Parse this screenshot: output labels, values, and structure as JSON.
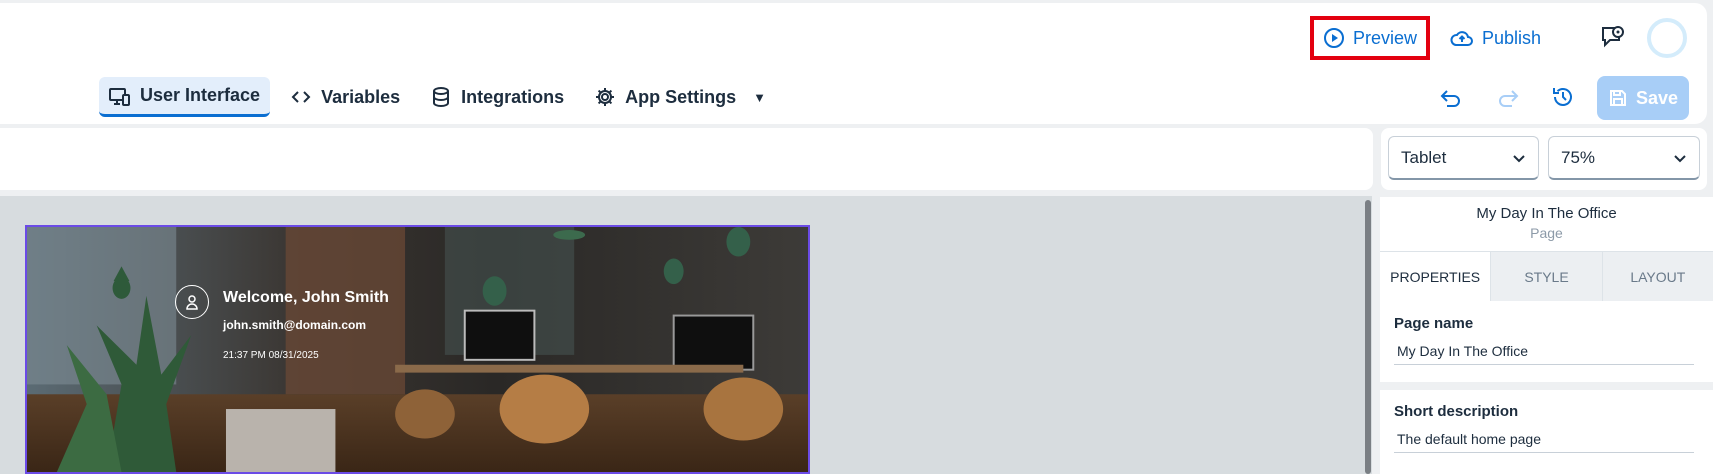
{
  "header": {
    "preview_label": "Preview",
    "publish_label": "Publish",
    "save_label": "Save"
  },
  "tabs": [
    {
      "label": "User Interface",
      "icon": "monitor-phone-icon",
      "active": true
    },
    {
      "label": "Variables",
      "icon": "code-icon",
      "active": false
    },
    {
      "label": "Integrations",
      "icon": "database-icon",
      "active": false
    },
    {
      "label": "App Settings",
      "icon": "gear-icon",
      "active": false
    }
  ],
  "selectors": {
    "device": "Tablet",
    "zoom": "75%"
  },
  "canvas": {
    "welcome_title": "Welcome, John Smith",
    "email": "john.smith@domain.com",
    "timestamp": "21:37 PM 08/31/2025"
  },
  "panel": {
    "title": "My Day In The Office",
    "subtitle": "Page",
    "tabs": [
      "PROPERTIES",
      "STYLE",
      "LAYOUT"
    ],
    "page_name_label": "Page name",
    "page_name_value": "My Day In The Office",
    "short_desc_label": "Short description",
    "short_desc_value": "The default home page"
  },
  "colors": {
    "accent": "#0a6ed1",
    "highlight_box": "#e3000f",
    "selection_frame": "#6b4be6",
    "save_disabled": "#a8cef7"
  }
}
